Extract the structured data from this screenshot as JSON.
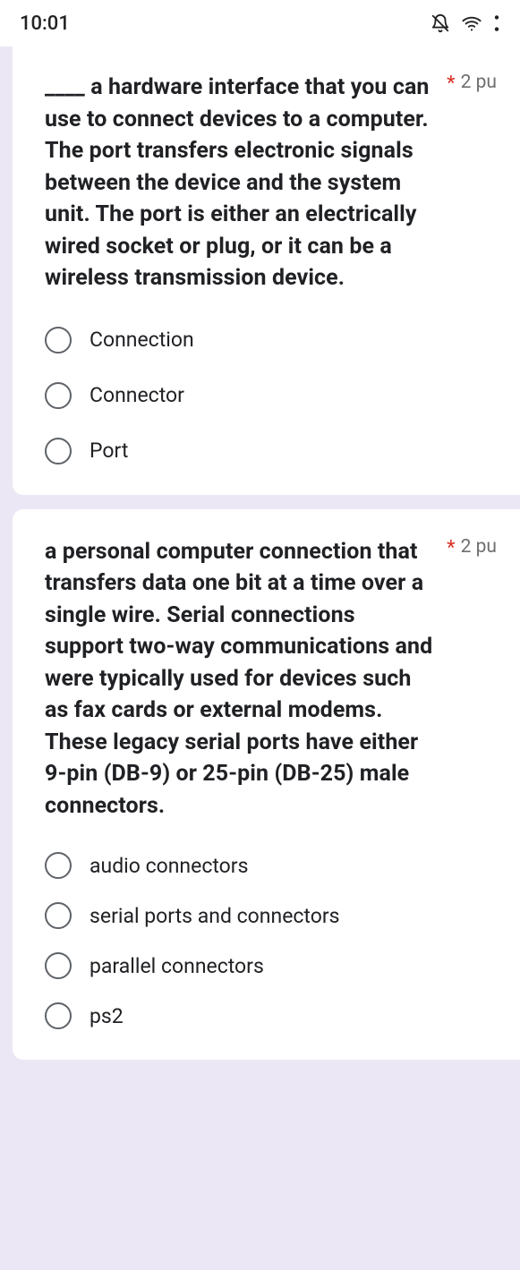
{
  "status": {
    "time": "10:01",
    "icons": [
      "bell-off-icon",
      "wifi-icon",
      "signal-icon"
    ]
  },
  "questions": [
    {
      "prompt": "____ a hardware interface that you can use to connect devices to a computer. The port transfers electronic signals between the device and the system unit. The port is either an electrically wired socket or plug, or it can be a wireless transmission device.",
      "required_mark": "*",
      "points_label": "2 pu",
      "options": [
        "Connection",
        "Connector",
        "Port"
      ]
    },
    {
      "prompt": "a personal computer connection that transfers data one bit at a time over a single wire. Serial connections support two-way communications and were typically used for devices such as fax cards or external modems. These legacy serial ports have either 9-pin (DB-9) or 25-pin (DB-25) male connectors.",
      "required_mark": "*",
      "points_label": "2 pu",
      "options": [
        "audio connectors",
        "serial ports and connectors",
        "parallel connectors",
        "ps2"
      ]
    }
  ]
}
